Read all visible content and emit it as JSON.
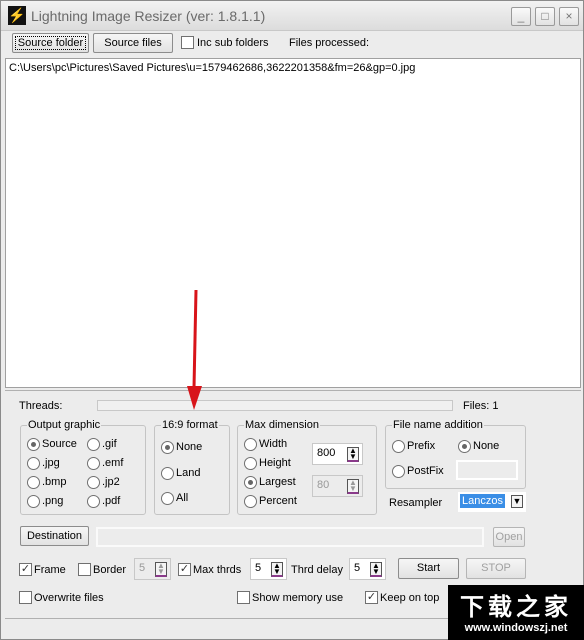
{
  "window": {
    "title": "Lightning Image Resizer (ver: 1.8.1.1)",
    "app_icon": "lightning-bolt-icon",
    "controls": {
      "minimize": "_",
      "maximize": "□",
      "close": "×"
    }
  },
  "toolbar": {
    "source_folder": "Source folder",
    "source_files": "Source files",
    "inc_sub_folders": {
      "label": "Inc sub folders",
      "checked": false
    },
    "files_processed_label": "Files processed:"
  },
  "file_list": [
    "C:\\Users\\pc\\Pictures\\Saved Pictures\\u=1579462686,3622201358&fm=26&gp=0.jpg"
  ],
  "status": {
    "threads_label": "Threads:",
    "threads_progress": 0,
    "files_label": "Files: 1"
  },
  "output_graphic": {
    "title": "Output graphic",
    "options": [
      {
        "label": "Source",
        "selected": true
      },
      {
        "label": ".gif",
        "selected": false
      },
      {
        "label": ".jpg",
        "selected": false
      },
      {
        "label": ".emf",
        "selected": false
      },
      {
        "label": ".bmp",
        "selected": false
      },
      {
        "label": ".jp2",
        "selected": false
      },
      {
        "label": ".png",
        "selected": false
      },
      {
        "label": ".pdf",
        "selected": false
      }
    ]
  },
  "format_169": {
    "title": "16:9 format",
    "options": [
      {
        "label": "None",
        "selected": true
      },
      {
        "label": "Land",
        "selected": false
      },
      {
        "label": "All",
        "selected": false
      }
    ]
  },
  "max_dimension": {
    "title": "Max dimension",
    "options": [
      {
        "label": "Width",
        "selected": false
      },
      {
        "label": "Height",
        "selected": false
      },
      {
        "label": "Largest",
        "selected": true
      },
      {
        "label": "Percent",
        "selected": false
      }
    ],
    "size_value": "800",
    "percent_value": "80"
  },
  "file_name_addition": {
    "title": "File name addition",
    "options": [
      {
        "label": "Prefix",
        "selected": false
      },
      {
        "label": "None",
        "selected": true
      },
      {
        "label": "PostFix",
        "selected": false
      }
    ],
    "text_value": ""
  },
  "resampler": {
    "label": "Resampler",
    "value": "Lanczos"
  },
  "destination": {
    "button": "Destination",
    "path": "",
    "open": "Open"
  },
  "options_row": {
    "frame": {
      "label": "Frame",
      "checked": true
    },
    "border": {
      "label": "Border",
      "checked": false,
      "value": "5"
    },
    "max_thrds": {
      "label": "Max thrds",
      "checked": true,
      "value": "5"
    },
    "thrd_delay": {
      "label": "Thrd delay",
      "value": "5"
    },
    "start": "Start",
    "stop": "STOP"
  },
  "bottom_row": {
    "overwrite": {
      "label": "Overwrite files",
      "checked": false
    },
    "show_memory": {
      "label": "Show memory use",
      "checked": false
    },
    "keep_on_top": {
      "label": "Keep on top",
      "checked": true
    }
  },
  "watermark": {
    "title": "下载之家",
    "url": "www.windowszj.net"
  }
}
